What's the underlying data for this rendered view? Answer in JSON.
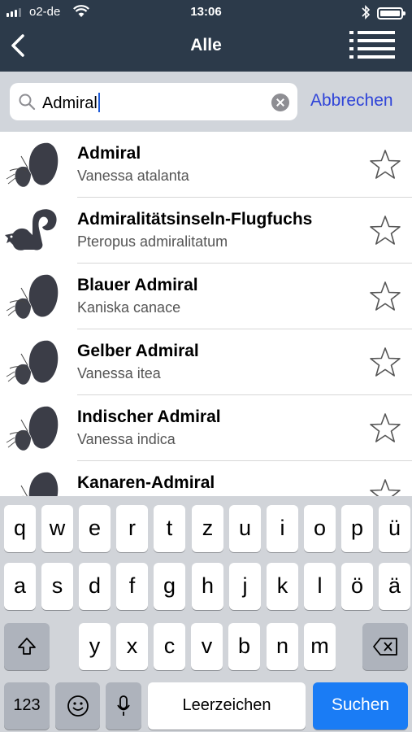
{
  "status": {
    "carrier": "o2-de",
    "time": "13:06"
  },
  "nav": {
    "title": "Alle"
  },
  "search": {
    "query": "Admiral",
    "cancel_label": "Abbrechen"
  },
  "results": [
    {
      "name": "Admiral",
      "scientific": "Vanessa atalanta",
      "icon": "butterfly-icon"
    },
    {
      "name": "Admiralitätsinseln-Flugfuchs",
      "scientific": "Pteropus admiralitatum",
      "icon": "squirrel-icon"
    },
    {
      "name": "Blauer Admiral",
      "scientific": "Kaniska canace",
      "icon": "butterfly-icon"
    },
    {
      "name": "Gelber Admiral",
      "scientific": "Vanessa itea",
      "icon": "butterfly-icon"
    },
    {
      "name": "Indischer Admiral",
      "scientific": "Vanessa indica",
      "icon": "butterfly-icon"
    },
    {
      "name": "Kanaren-Admiral",
      "scientific": "",
      "icon": "butterfly-icon"
    }
  ],
  "keyboard": {
    "row1": [
      "q",
      "w",
      "e",
      "r",
      "t",
      "z",
      "u",
      "i",
      "o",
      "p",
      "ü"
    ],
    "row2": [
      "a",
      "s",
      "d",
      "f",
      "g",
      "h",
      "j",
      "k",
      "l",
      "ö",
      "ä"
    ],
    "row3": [
      "y",
      "x",
      "c",
      "v",
      "b",
      "n",
      "m"
    ],
    "numbers_label": "123",
    "space_label": "Leerzeichen",
    "return_label": "Suchen"
  },
  "colors": {
    "nav_bg": "#2c3a4a",
    "accent": "#2f44d8",
    "return_key": "#1a7cf5"
  }
}
